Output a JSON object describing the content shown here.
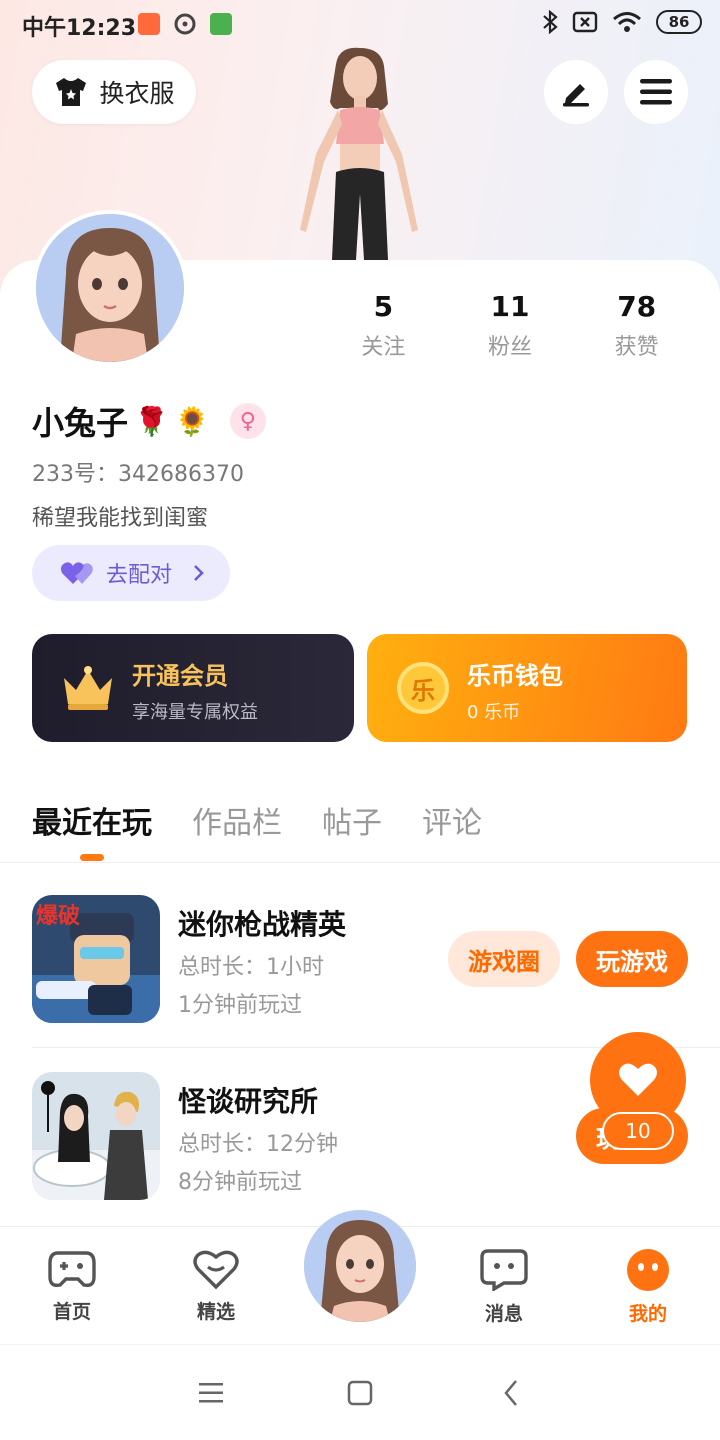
{
  "status_bar": {
    "time": "中午12:23",
    "battery": "86"
  },
  "header": {
    "outfit_label": "换衣服"
  },
  "stats": [
    {
      "value": "5",
      "label": "关注"
    },
    {
      "value": "11",
      "label": "粉丝"
    },
    {
      "value": "78",
      "label": "获赞"
    }
  ],
  "profile": {
    "name": "小兔子",
    "name_emojis": [
      "🌹",
      "🌻"
    ],
    "gender_symbol": "♀",
    "id_text": "233号：342686370",
    "bio": "稀望我能找到闺蜜",
    "match_label": "去配对"
  },
  "vip": {
    "title": "开通会员",
    "subtitle": "享海量专属权益"
  },
  "wallet": {
    "title": "乐币钱包",
    "subtitle": "0 乐币",
    "coin_char": "乐"
  },
  "tabs": [
    {
      "label": "最近在玩",
      "active": true
    },
    {
      "label": "作品栏",
      "active": false
    },
    {
      "label": "帖子",
      "active": false
    },
    {
      "label": "评论",
      "active": false
    }
  ],
  "games": [
    {
      "name": "迷你枪战精英",
      "duration": "总时长：1小时",
      "last_played": "1分钟前玩过",
      "circle_label": "游戏圈",
      "play_label": "玩游戏",
      "badge": "爆破"
    },
    {
      "name": "怪谈研究所",
      "duration": "总时长：12分钟",
      "last_played": "8分钟前玩过",
      "play_label": "玩"
    }
  ],
  "fab": {
    "count": "10"
  },
  "bottom_nav": [
    {
      "label": "首页",
      "active": false
    },
    {
      "label": "精选",
      "active": false
    },
    {
      "label": "消息",
      "active": false
    },
    {
      "label": "我的",
      "active": true
    }
  ],
  "colors": {
    "accent": "#ff7212",
    "match_purple": "#6b5bd6",
    "vip_gold": "#f7c35a"
  }
}
